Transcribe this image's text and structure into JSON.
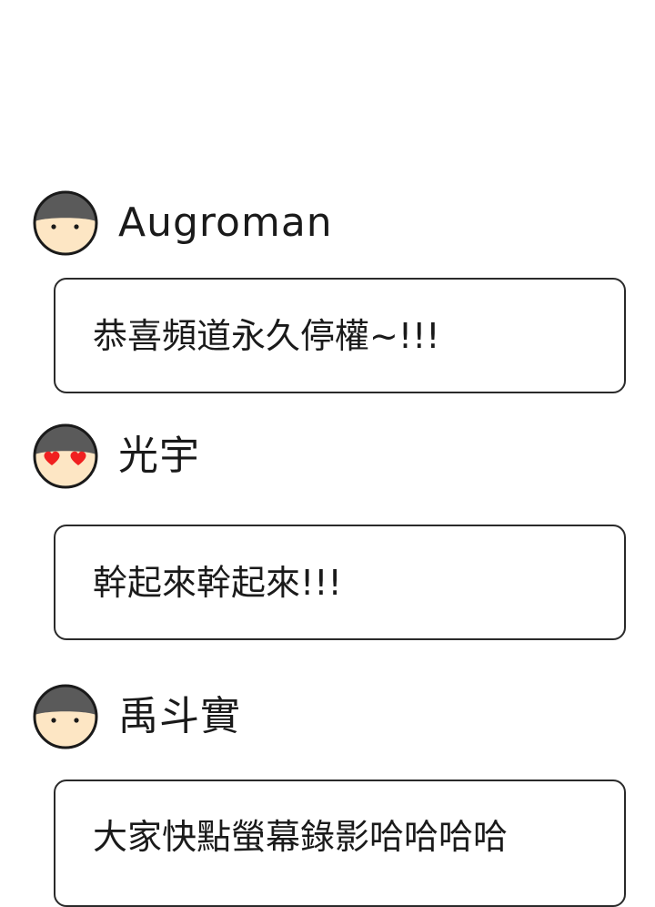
{
  "comments": [
    {
      "username": "Augroman",
      "avatar": {
        "icon": "plain-face-icon",
        "eyes": "dots"
      },
      "text": "恭喜頻道永久停權~!!!"
    },
    {
      "username": "光宇",
      "avatar": {
        "icon": "heart-eyes-face-icon",
        "eyes": "hearts"
      },
      "text": "幹起來幹起來!!!"
    },
    {
      "username": "禹斗實",
      "avatar": {
        "icon": "plain-face-icon",
        "eyes": "dots"
      },
      "text": "大家快點螢幕錄影哈哈哈哈"
    }
  ],
  "colors": {
    "skin": "#fde6c4",
    "hair": "#5a5a5a",
    "outline": "#1a1a1a",
    "heart": "#f02020",
    "bubble_border": "#2a2a2a"
  }
}
